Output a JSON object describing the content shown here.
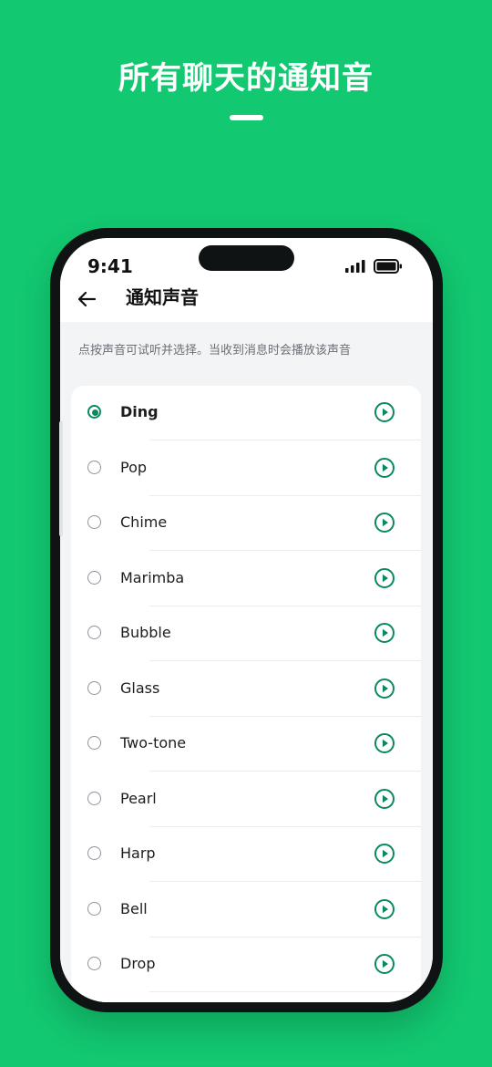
{
  "promo": {
    "title": "所有聊天的通知音"
  },
  "status": {
    "time": "9:41"
  },
  "header": {
    "title": "通知声音"
  },
  "hint": "点按声音可试听并选择。当收到消息时会播放该声音",
  "sounds": [
    {
      "label": "Ding",
      "selected": true
    },
    {
      "label": "Pop",
      "selected": false
    },
    {
      "label": "Chime",
      "selected": false
    },
    {
      "label": "Marimba",
      "selected": false
    },
    {
      "label": "Bubble",
      "selected": false
    },
    {
      "label": "Glass",
      "selected": false
    },
    {
      "label": "Two-tone",
      "selected": false
    },
    {
      "label": "Pearl",
      "selected": false
    },
    {
      "label": "Harp",
      "selected": false
    },
    {
      "label": "Bell",
      "selected": false
    },
    {
      "label": "Drop",
      "selected": false
    }
  ],
  "icons": {
    "back": "arrow-left-icon",
    "play": "play-circle-icon",
    "signal": "signal-icon",
    "battery": "battery-icon"
  },
  "colors": {
    "background": "#12c870",
    "accent": "#0a8a5c",
    "screen_bg": "#f3f4f6"
  }
}
